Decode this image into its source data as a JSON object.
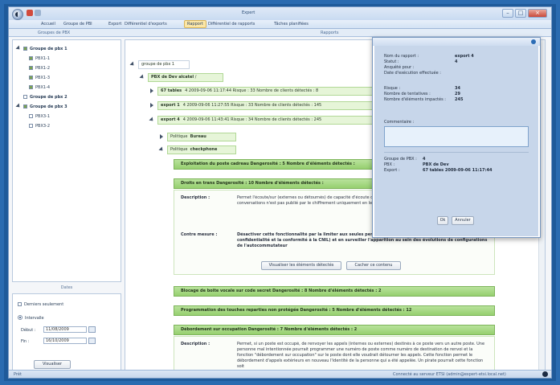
{
  "window": {
    "title": "Expert"
  },
  "menu": {
    "items": [
      "Accueil",
      "Groupe de PBI",
      "Export",
      "Différentiel d'exports",
      "Rapport",
      "Différentiel de rapports",
      "Tâches planifiées"
    ],
    "active_index": 4
  },
  "ribbon": {
    "left_header": "Groupes de PBX",
    "right_header": "Rapports"
  },
  "tree": {
    "items": [
      {
        "label": "Groupe de pbx 1",
        "level": 0,
        "checked": true,
        "expanded": true
      },
      {
        "label": "PBX1-1",
        "level": 1,
        "checked": true
      },
      {
        "label": "PBX1-2",
        "level": 1,
        "checked": true
      },
      {
        "label": "PBX1-3",
        "level": 1,
        "checked": true
      },
      {
        "label": "PBX1-4",
        "level": 1,
        "checked": true
      },
      {
        "label": "Groupe de pbx 2",
        "level": 0,
        "checked": false,
        "expanded": false
      },
      {
        "label": "Groupe de pbx 3",
        "level": 0,
        "checked": true,
        "expanded": true
      },
      {
        "label": "PBX3-1",
        "level": 1,
        "checked": false
      },
      {
        "label": "PBX3-2",
        "level": 1,
        "checked": false
      }
    ]
  },
  "dates": {
    "header": "Dates",
    "option_today": "Derniers seulement",
    "option_interval": "Intervalle",
    "from_label": "Début :",
    "from_value": "11/08/2009",
    "to_label": "Fin :",
    "to_value": "16/10/2009",
    "view_button": "Visualiser"
  },
  "report_tree": {
    "group_root": "groupe de pbx 1",
    "pbx_node_label": "PBX de Dev",
    "pbx_node_value": "alcatel",
    "pbx_node_suffix": "/",
    "rows": [
      {
        "label": "67 tables",
        "text": "4  2009-09-06 11:17:44  Risque :  33  Nombre de clients détectés :  8"
      },
      {
        "label": "export 1",
        "text": "4  2009-09-06 11:27:55  Risque :  33  Nombre de clients détectés : 145"
      },
      {
        "label": "export 4",
        "text": "4  2009-09-06 11:43:41  Risque :  34  Nombre de clients détectés : 245"
      }
    ],
    "politique_1_label": "Politique",
    "politique_1_value": "Bureau",
    "politique_2_label": "Politique",
    "politique_2_value": "checkphone"
  },
  "findings": [
    {
      "title": "Exploitation du poste cadreau   Dangerosité :  5   Nombre d'éléments détectés :"
    },
    {
      "title": "Droits en trans   Dangerosité :  10   Nombre d'éléments détectés :"
    },
    {
      "title": "Blocage de boite vocale sur code secret   Dangerosité :  8   Nombre d'éléments détectés :  2"
    },
    {
      "title": "Programmation des touches reparties non protégée   Dangerosité :  5   Nombre d'éléments détectés :  12"
    },
    {
      "title": "Débordement sur occupation   Dangerosité :  7   Nombre d'éléments détectés :  2"
    }
  ],
  "detail1": {
    "description_label": "Description :",
    "description_text": "Permet l'écoute/sur (externes ou détournés) de capacité d'écoute ou d'enregistrement des conversations n'est pas publié par le chiffrement uniquement en lecture",
    "contre_label": "Contre mesure :",
    "contre_text": "Désactiver cette fonctionnalité par la limiter aux seules personnes strictement autorisées (critique pour la confidentialité et la conformité à la CNIL) et en surveiller l'apparition au sein des évolutions de configurations de l'autocommutateur",
    "btn_view": "Visualiser les éléments détectés",
    "btn_hide": "Cacher ce contenu"
  },
  "detail2": {
    "description_label": "Description :",
    "description_text": "Permet, si un poste est occupé, de renvoyer les appels (internes ou externes) destinés à ce poste vers un autre poste. Une personne mal intentionnée pourrait programmer une numéro de poste comme numéro de destination de renvoi et la fonction \"débordement sur occupation\" sur le poste dont elle voudrait détourner les appels. Cette fonction permet le débordement d'appels extérieurs en nouveau l'identité de la personne qui a été appelée. Un pirate pourrait cette fonction soit"
  },
  "popup": {
    "rows": [
      {
        "k": "Nom du rapport :",
        "v": "export 4"
      },
      {
        "k": "Statut :",
        "v": "4"
      },
      {
        "k": "Anquêté pour :",
        "v": ""
      },
      {
        "k": "Date d'exécution effectuée :",
        "v": ""
      },
      {
        "k": "Risque :",
        "v": "34"
      },
      {
        "k": "Nombre de tentatives :",
        "v": "29"
      },
      {
        "k": "Nombre d'éléments impactés :",
        "v": "245"
      }
    ],
    "comment_label": "Commentaire :",
    "info": [
      {
        "k": "Groupe de PBX :",
        "v": "4"
      },
      {
        "k": "PBX :",
        "v": "PBX de Dev"
      },
      {
        "k": "Export :",
        "v": "67 tables 2009-09-06 11:17:44"
      }
    ],
    "ok": "Ok",
    "cancel": "Annuler"
  },
  "status": {
    "left": "Prêt",
    "right": "Connecté au serveur ETSI (admin@expert-etsi.local.net)"
  },
  "colors": {
    "group_bar": "#96cf6f",
    "accent": "#2b6cb5",
    "popup_bg": "#c7d6ea"
  }
}
